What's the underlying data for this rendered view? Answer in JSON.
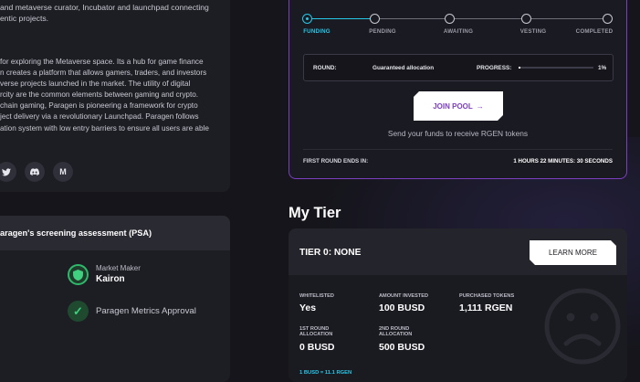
{
  "project": {
    "intro_text": "and metaverse curator, Incubator and launchpad connecting\nentic projects.",
    "description": " for exploring the Metaverse space. Its a hub for game finance\nn creates a platform that allows gamers, traders, and investors\nverse projects launched in the market. The utility of digital\nrcity are the common elements between gaming and crypto.\nchain gaming, Paragen is pioneering a framework for crypto\nject delivery via a revolutionary Launchpad. Paragen follows\nation system with low entry barriers to ensure all users are able",
    "socials": [
      {
        "icon": "twitter-icon",
        "glyph": "𝕏"
      },
      {
        "icon": "discord-icon",
        "glyph": "◙"
      },
      {
        "icon": "medium-icon",
        "glyph": "M"
      }
    ]
  },
  "psa": {
    "title": "aragen's screening assessment (PSA)",
    "market_maker_label": "Market Maker",
    "market_maker_name": "Kairon",
    "metrics_label": "Paragen Metrics Approval"
  },
  "pool": {
    "steps": [
      {
        "label": "FUNDING",
        "active": true
      },
      {
        "label": "PENDING",
        "active": false
      },
      {
        "label": "AWAITING",
        "active": false
      },
      {
        "label": "VESTING",
        "active": false
      },
      {
        "label": "COMPLETED",
        "active": false
      }
    ],
    "round_label": "ROUND:",
    "round_value": "Guaranteed allocation",
    "progress_label": "PROGRESS:",
    "progress_value": "1%",
    "progress_fraction": 0.01,
    "join_label": "JOIN POOL",
    "join_arrow": "→",
    "send_text": "Send your funds to receive RGEN tokens",
    "ends_label": "FIRST ROUND ENDS IN:",
    "ends_value": "1 HOURS 22 MINUTES: 30 SECONDS"
  },
  "tier": {
    "section_title": "My Tier",
    "title": "TIER 0: NONE",
    "learn_more": "LEARN MORE",
    "stats": {
      "whitelisted_label": "WHITELISTED",
      "whitelisted_value": "Yes",
      "amount_label": "AMOUNT INVESTED",
      "amount_value": "100 BUSD",
      "purchased_label": "PURCHASED TOKENS",
      "purchased_value": "1,111 RGEN",
      "first_alloc_label": "1ST ROUND\nALLOCATION",
      "first_alloc_value": "0 BUSD",
      "second_alloc_label": "2ND ROUND\nALLOCATION",
      "second_alloc_value": "500 BUSD"
    },
    "rate": "1 BUSD = 11.1 RGEN"
  },
  "colors": {
    "accent_cyan": "#27c7e8",
    "accent_purple": "#7b3fc0",
    "success_green": "#3ecf7e"
  }
}
